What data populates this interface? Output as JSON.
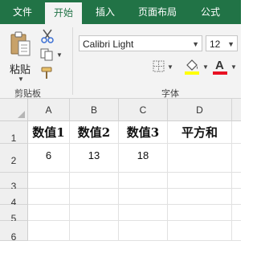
{
  "tabs": [
    {
      "label": "文件",
      "active": false
    },
    {
      "label": "开始",
      "active": true
    },
    {
      "label": "插入",
      "active": false
    },
    {
      "label": "页面布局",
      "active": false
    },
    {
      "label": "公式",
      "active": false
    }
  ],
  "ribbon": {
    "clipboard": {
      "paste_label": "粘贴",
      "group_label": "剪贴板"
    },
    "font": {
      "font_name": "Calibri Light",
      "font_size": "12",
      "group_label": "字体",
      "highlight_color": "#ffff00",
      "font_color": "#e81123"
    }
  },
  "sheet": {
    "columns": [
      "A",
      "B",
      "C",
      "D"
    ],
    "rows": [
      "1",
      "2",
      "3",
      "4",
      "5",
      "6"
    ],
    "cells": [
      [
        "数值1",
        "数值2",
        "数值3",
        "平方和"
      ],
      [
        "6",
        "13",
        "18",
        ""
      ],
      [
        "",
        "",
        "",
        ""
      ],
      [
        "",
        "",
        "",
        ""
      ],
      [
        "",
        "",
        "",
        ""
      ],
      [
        "",
        "",
        "",
        ""
      ]
    ]
  },
  "colors": {
    "accent": "#217346",
    "ribbon_bg": "#f3f3f3"
  }
}
